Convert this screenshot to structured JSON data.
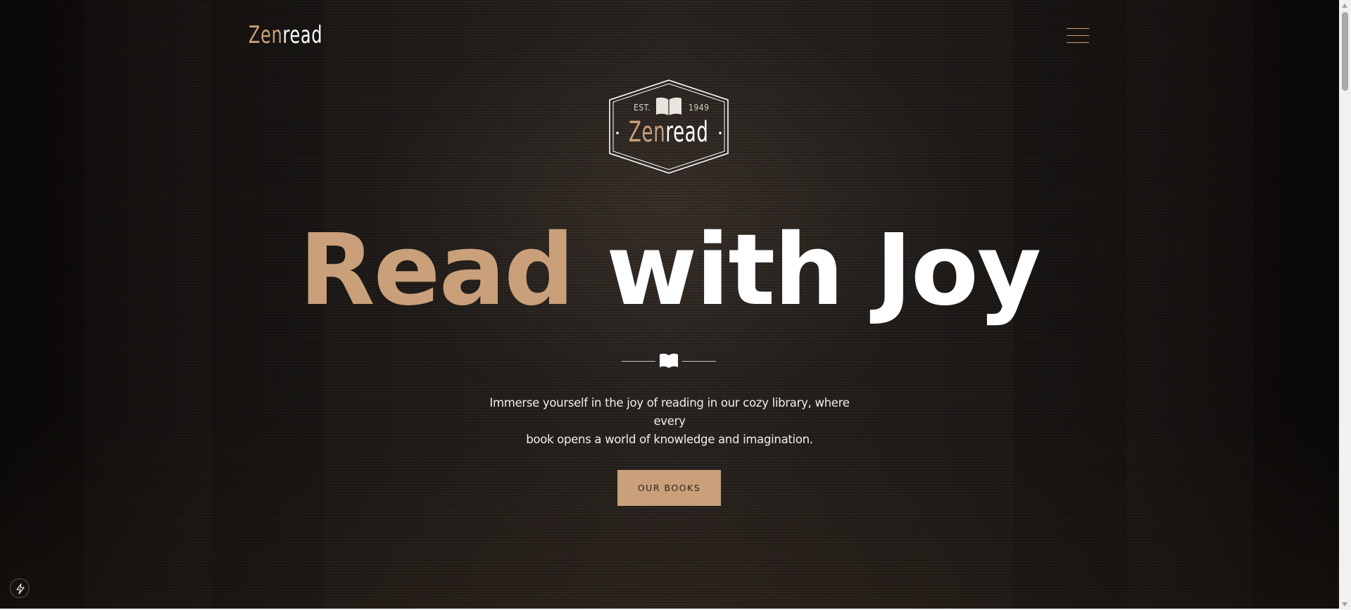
{
  "header": {
    "logo_zen": "Zen",
    "logo_read": "read",
    "menu_icon": "hamburger-menu-icon"
  },
  "badge": {
    "est_label": "EST.",
    "year": "1949",
    "name_zen": "Zen",
    "name_read": "read",
    "icon": "open-book-icon"
  },
  "hero": {
    "title_accent": "Read",
    "title_rest": "with Joy",
    "divider_icon": "open-book-icon",
    "tagline_line1": "Immerse yourself in the joy of reading in our cozy library, where every",
    "tagline_line2": "book opens a world of knowledge and imagination.",
    "cta_label": "OUR BOOKS"
  },
  "corner": {
    "icon": "lightning-bolt-icon"
  },
  "colors": {
    "accent": "#c9a07a",
    "background": "#171412",
    "text": "#ffffff"
  }
}
